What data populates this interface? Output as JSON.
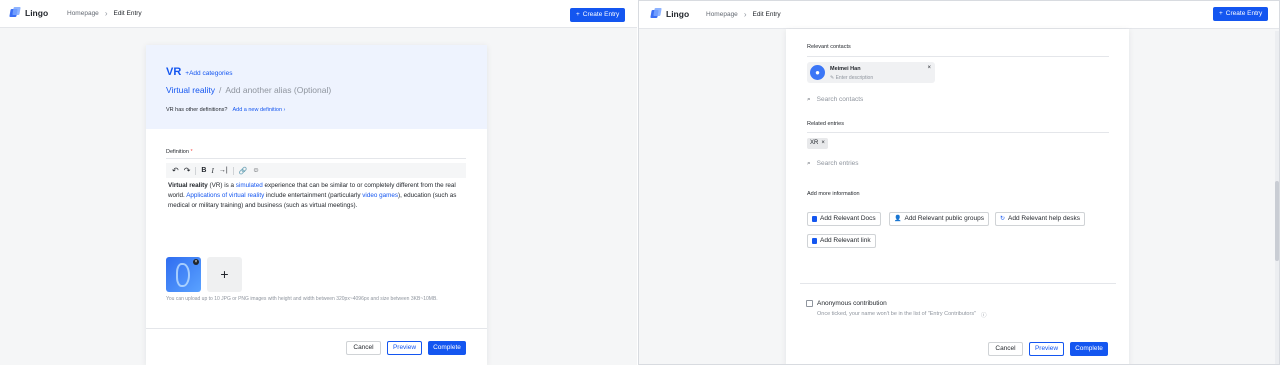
{
  "app": {
    "name": "Lingo"
  },
  "breadcrumb": {
    "home": "Homepage",
    "current": "Edit Entry"
  },
  "header": {
    "create_entry": "Create Entry"
  },
  "entry": {
    "term": "VR",
    "add_categories": "Add categories",
    "full_name": "Virtual reality",
    "slash": "/",
    "alias_placeholder": "Add another alias (Optional)",
    "other_definitions_q": "VR has other definitions?",
    "add_definition": "Add a new definition",
    "definition_label": "Definition",
    "required_mark": "*",
    "definition": {
      "b1": "Virtual reality",
      "t1": " (VR) is a ",
      "l1": "simulated",
      "t2": " experience that can be similar to or completely different from the real world. ",
      "l2": "Applications of virtual reality",
      "t3": " include entertainment (particularly ",
      "l3": "video games",
      "t4": "), education (such as medical or military training) and business (such as virtual meetings)."
    },
    "upload_hint": "You can upload up to 10 JPG or PNG images with height and width between 320px~4096px and size between 3KB~10MB."
  },
  "right": {
    "relevant_contacts": "Relevant contacts",
    "contact": {
      "name": "Meimei Han",
      "desc": "Enter description"
    },
    "search_contacts": "Search contacts",
    "related_entries": "Related entries",
    "related_tag": "XR",
    "search_entries": "Search entries",
    "add_more": "Add more information",
    "add_buttons": {
      "docs": "Add Relevant Docs",
      "groups": "Add Relevant public groups",
      "helpdesks": "Add Relevant help desks",
      "link": "Add Relevant link"
    },
    "anonymous": "Anonymous contribution",
    "anonymous_hint": "Once ticked, your name won't be in the list of \"Entry Contributors\""
  },
  "footer": {
    "cancel": "Cancel",
    "preview": "Preview",
    "complete": "Complete"
  },
  "colors": {
    "accent": "#1456f0",
    "header_tint": "#eef3fe"
  }
}
